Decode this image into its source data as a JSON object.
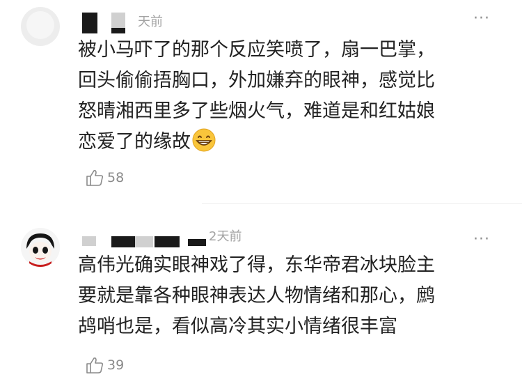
{
  "comments": [
    {
      "time_label": "天前",
      "text": "被小马吓了的那个反应笑喷了，扇一巴掌，\n回头偷偷捂胸口，外加嫌弃的眼神，感觉比\n怒晴湘西里多了些烟火气，难道是和红姑娘\n恋爱了的缘故",
      "emoji": "grinning-face-emoji",
      "like_count": "58",
      "more_label": "···"
    },
    {
      "time_label": "2天前",
      "text": "高伟光确实眼神戏了得，东华帝君冰块脸主\n要就是靠各种眼神表达人物情绪和那心，鹧\n鸪哨也是，看似高冷其实小情绪很丰富",
      "like_count": "39",
      "more_label": "···"
    }
  ],
  "colors": {
    "text": "#222222",
    "meta": "#a3a3a3",
    "redaction": "#1a1a1a"
  }
}
